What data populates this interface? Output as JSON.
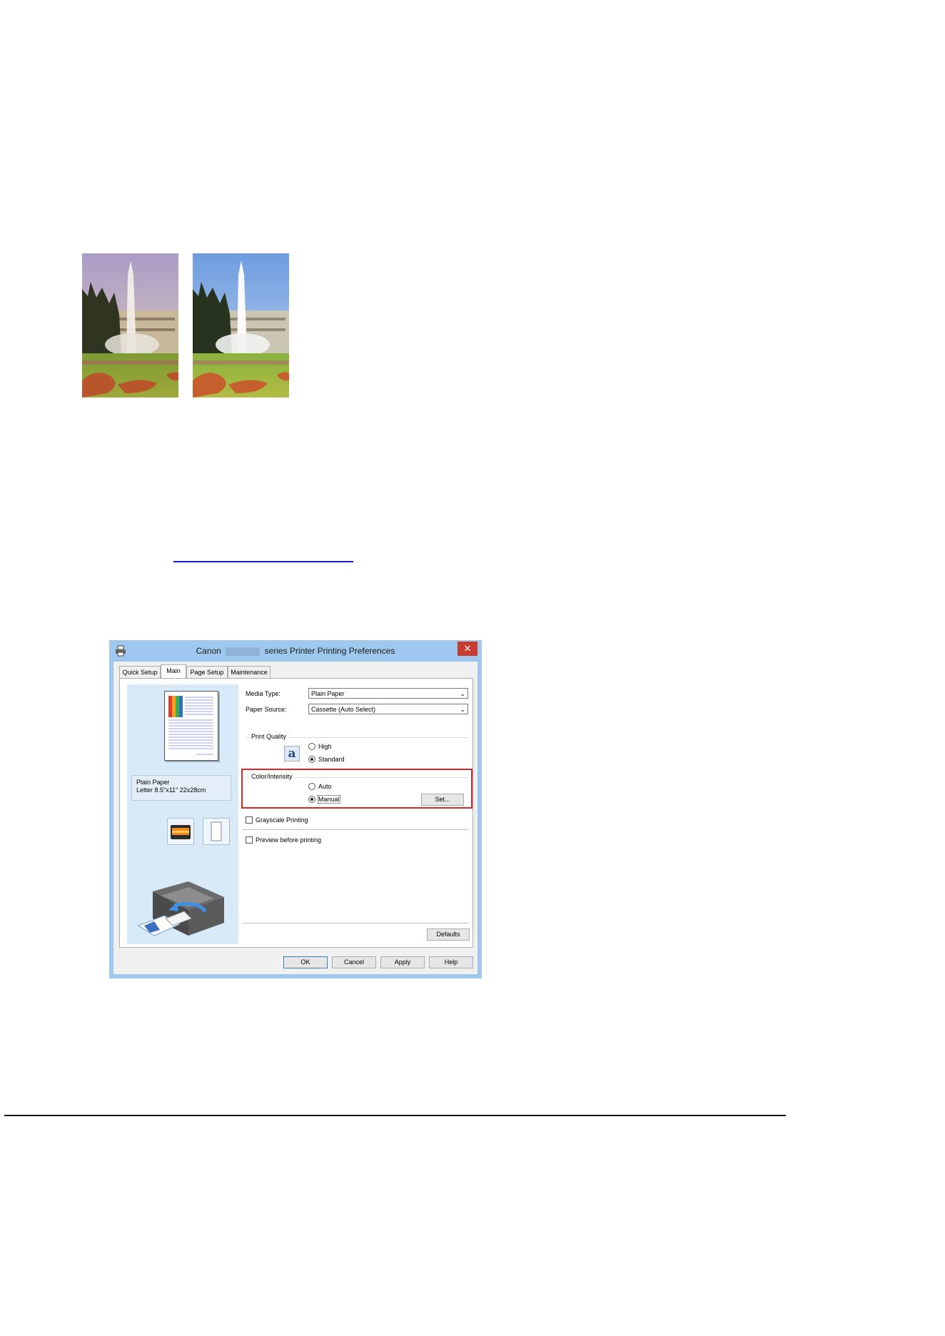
{
  "link": {
    "text": ""
  },
  "dialog": {
    "title_prefix": "Canon",
    "title_suffix": "series Printer Printing Preferences",
    "close_label": "✕",
    "tabs": [
      "Quick Setup",
      "Main",
      "Page Setup",
      "Maintenance"
    ],
    "active_tab": "Main",
    "paper_info": {
      "line1": "Plain Paper",
      "line2": "Letter 8.5\"x11\" 22x28cm"
    },
    "media_type": {
      "label": "Media Type:",
      "value": "Plain Paper"
    },
    "paper_source": {
      "label": "Paper Source:",
      "value": "Cassette (Auto Select)"
    },
    "print_quality": {
      "label": "Print Quality",
      "icon": "a",
      "options": [
        {
          "label": "High",
          "selected": false
        },
        {
          "label": "Standard",
          "selected": true
        }
      ]
    },
    "color_intensity": {
      "label": "Color/Intensity",
      "options": [
        {
          "label": "Auto",
          "selected": false
        },
        {
          "label": "Manual",
          "selected": true
        }
      ],
      "set_button": "Set..."
    },
    "grayscale": {
      "label": "Grayscale Printing",
      "checked": false
    },
    "preview": {
      "label": "Preview before printing",
      "checked": false
    },
    "defaults_button": "Defaults",
    "buttons": {
      "ok": "OK",
      "cancel": "Cancel",
      "apply": "Apply",
      "help": "Help"
    },
    "colors": {
      "frame": "#9fc8ee",
      "close": "#c83c2f",
      "highlight": "#d9262b",
      "left_pane": "#d8e9f8"
    }
  }
}
